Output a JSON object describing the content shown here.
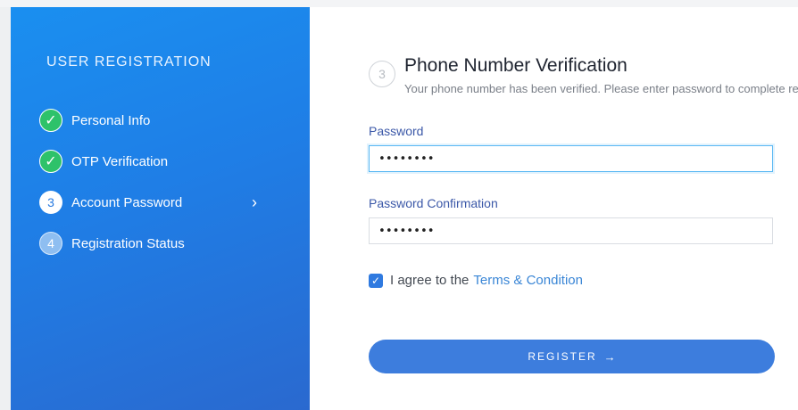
{
  "sidebar": {
    "title": "USER REGISTRATION",
    "steps": [
      {
        "badge": "✓",
        "label": "Personal Info",
        "state": "done"
      },
      {
        "badge": "✓",
        "label": "OTP Verification",
        "state": "done"
      },
      {
        "badge": "3",
        "label": "Account Password",
        "state": "current"
      },
      {
        "badge": "4",
        "label": "Registration Status",
        "state": "pending"
      }
    ],
    "chevron_icon": "chevron-right-icon",
    "gradient_colors": [
      "#1a8ff0",
      "#2a69cf"
    ]
  },
  "main": {
    "step_number": "3",
    "heading": "Phone Number Verification",
    "subtext": "Your phone number has been verified. Please enter password to complete registration.",
    "password": {
      "label": "Password",
      "value": "••••••••"
    },
    "password_confirmation": {
      "label": "Password Confirmation",
      "value": "••••••••"
    },
    "agree": {
      "checked": true,
      "text": "I agree to the",
      "link": "Terms & Condition"
    },
    "register_button": {
      "label": "REGISTER",
      "arrow": "→"
    }
  },
  "colors": {
    "accent": "#3d7ddd",
    "success": "#2ec26a",
    "label": "#3b58a8",
    "link": "#3a86d6"
  }
}
